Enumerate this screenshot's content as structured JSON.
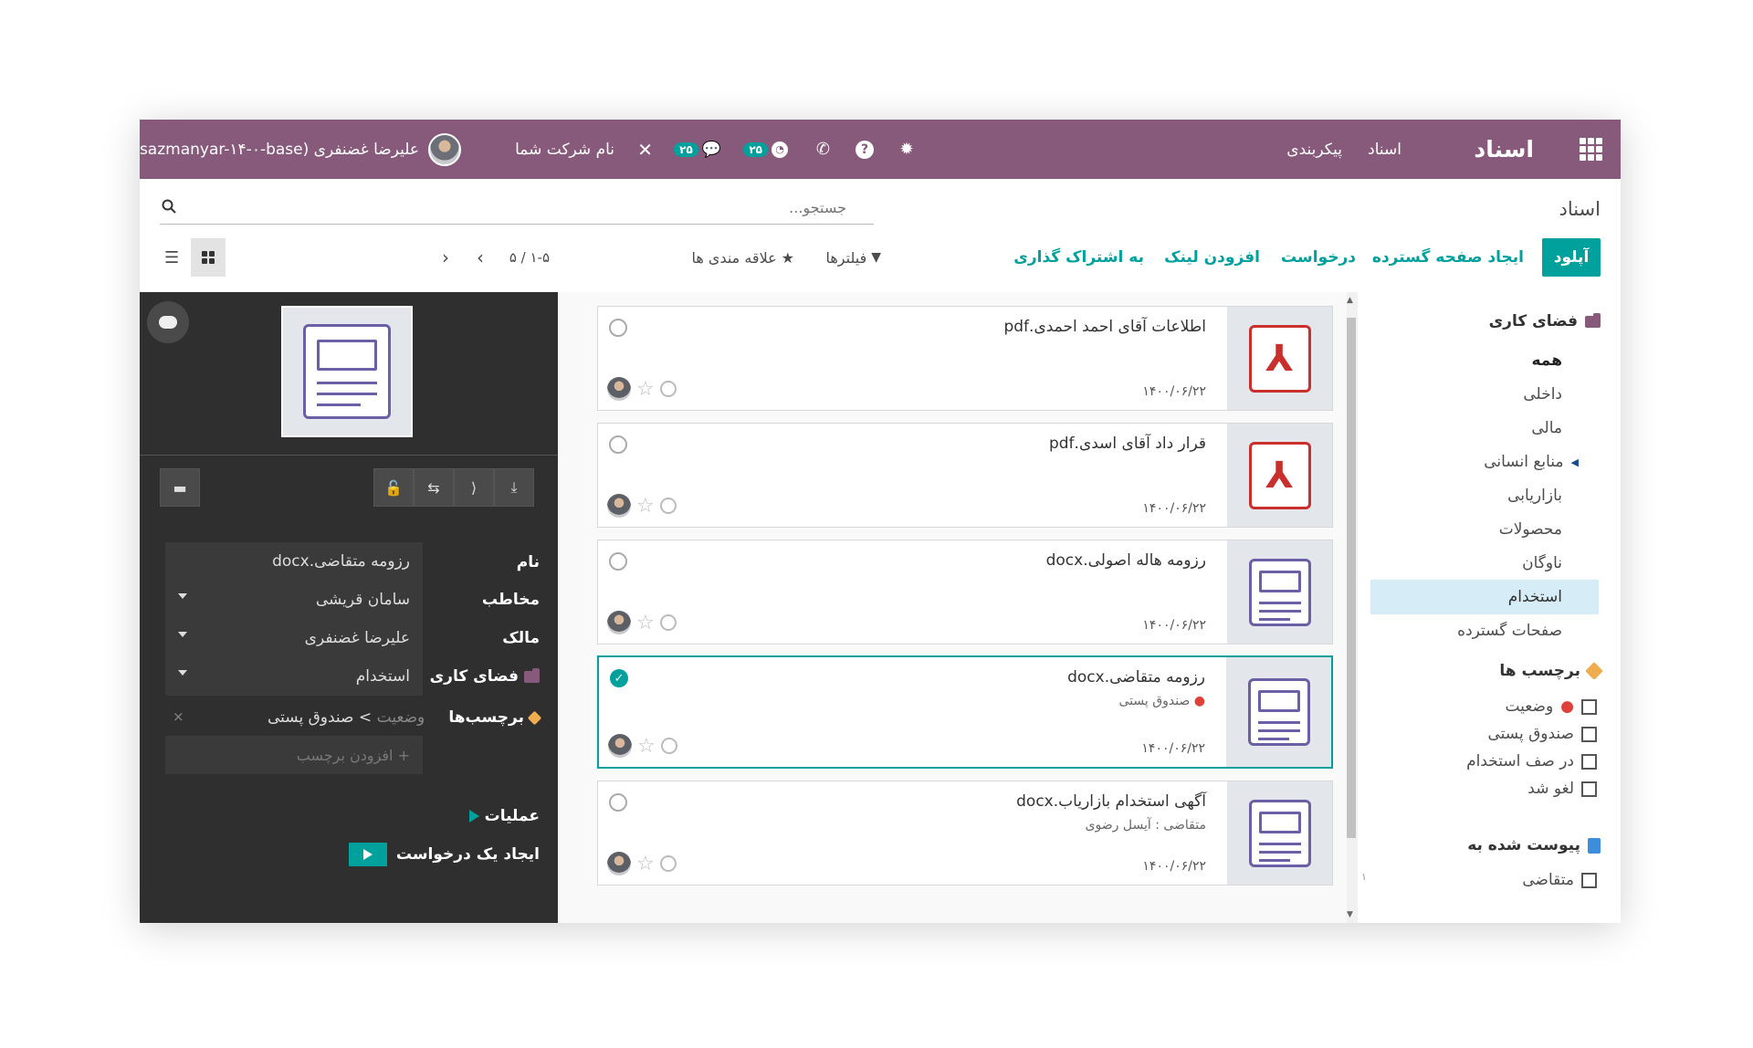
{
  "navbar": {
    "app_title": "اسناد",
    "menu_documents": "اسناد",
    "menu_config": "پیکربندی",
    "activity_badge": "۲۵",
    "messages_badge": "۲۵",
    "company_name": "نام شرکت شما",
    "user_name": "علیرضا غضنفری (sazmanyar-۱۴-۰-base)"
  },
  "control": {
    "breadcrumb": "اسناد",
    "search_placeholder": "جستجو...",
    "upload": "آپلود",
    "create_spreadsheet": "ایجاد صفحه گسترده",
    "request": "درخواست",
    "add_link": "افزودن لینک",
    "share": "به اشتراک گذاری",
    "filters": "فیلترها",
    "favorites": "علاقه مندی ها",
    "pager": "۱-۵ / ۵"
  },
  "sidebar": {
    "workspace_title": "فضای کاری",
    "workspaces": [
      {
        "label": "همه",
        "bold": true
      },
      {
        "label": "داخلی"
      },
      {
        "label": "مالی"
      },
      {
        "label": "منابع انسانی"
      },
      {
        "label": "بازاریابی"
      },
      {
        "label": "محصولات"
      },
      {
        "label": "ناوگان"
      },
      {
        "label": "استخدام",
        "active": true
      },
      {
        "label": "صفحات گسترده"
      }
    ],
    "tags_title": "برچسب ها",
    "tags": [
      "وضعیت",
      "صندوق پستی",
      "در صف استخدام",
      "لغو شد"
    ],
    "attached_title": "پیوست شده به",
    "attached": [
      {
        "label": "متقاضی",
        "count": "۱"
      }
    ]
  },
  "documents": [
    {
      "name": "اطلاعات آقای احمد احمدی.pdf",
      "date": "۱۴۰۰/۰۶/۲۲",
      "type": "pdf",
      "sub": ""
    },
    {
      "name": "قرار داد آقای اسدی.pdf",
      "date": "۱۴۰۰/۰۶/۲۲",
      "type": "pdf",
      "sub": ""
    },
    {
      "name": "رزومه هاله اصولی.docx",
      "date": "۱۴۰۰/۰۶/۲۲",
      "type": "doc",
      "sub": ""
    },
    {
      "name": "رزومه متقاضی.docx",
      "date": "۱۴۰۰/۰۶/۲۲",
      "type": "doc",
      "sub": "صندوق پستی",
      "selected": true
    },
    {
      "name": "آگهی استخدام بازاریاب.docx",
      "date": "۱۴۰۰/۰۶/۲۲",
      "type": "doc",
      "sub": "متقاضی : آیسل رضوی"
    }
  ],
  "inspector": {
    "name_label": "نام",
    "name_value": "رزومه متقاضی.docx",
    "contact_label": "مخاطب",
    "contact_value": "سامان قریشی",
    "owner_label": "مالک",
    "owner_value": "علیرضا غضنفری",
    "workspace_label": "فضای کاری",
    "workspace_value": "استخدام",
    "tags_label": "برچسب‌ها",
    "tag_category": "وضعیت",
    "tag_value": "صندوق پستی",
    "tag_remove": "×",
    "add_tag_placeholder": "+ افزودن برچسب",
    "operations_label": "عملیات",
    "create_request": "ایجاد یک درخواست"
  },
  "colors": {
    "primary": "#875a7b",
    "accent": "#00a09d",
    "panel": "#2f2f2f"
  }
}
